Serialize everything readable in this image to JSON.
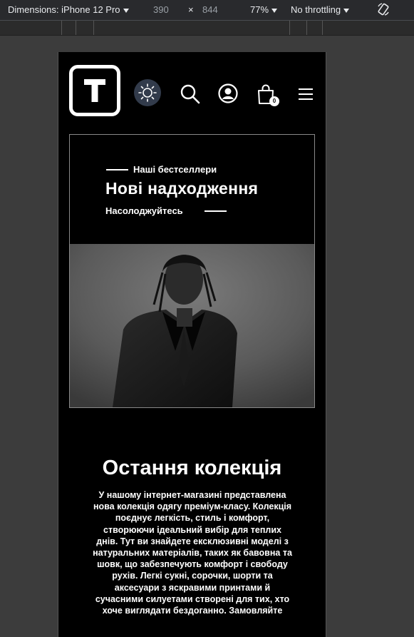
{
  "devtools": {
    "dimensions_label": "Dimensions: iPhone 12 Pro",
    "width": "390",
    "times": "×",
    "height": "844",
    "zoom": "77%",
    "throttling": "No throttling",
    "rotate_icon": "rotate-icon"
  },
  "header": {
    "logo_letter": "T",
    "logo_icon": "logo-t-icon",
    "theme_icon": "sun-icon",
    "search_icon": "search-icon",
    "account_icon": "user-circle-icon",
    "cart_icon": "shopping-bag-icon",
    "cart_count": "0",
    "menu_icon": "hamburger-menu-icon"
  },
  "hero": {
    "eyebrow": "Наші бестселлери",
    "title": "Нові надходження",
    "subtitle": "Насолоджуйтесь",
    "image_alt": "model-photo"
  },
  "section": {
    "title": "Остання колекція",
    "text": "У нашому інтернет-магазині представлена нова колекція одягу преміум-класу. Колекція поєднує легкість, стиль і комфорт, створюючи ідеальний вибір для теплих днів. Тут ви знайдете ексклюзивні моделі з натуральних матеріалів, таких як бавовна та шовк, що забезпечують комфорт і свободу рухів. Легкі сукні, сорочки, шорти та аксесуари з яскравими принтами й сучасними силуетами створені для тих, хто хоче виглядати бездоганно. Замовляйте"
  },
  "colors": {
    "page_bg": "#000000",
    "text": "#ffffff",
    "theme_button_bg": "#323b4b",
    "devtools_bg": "#292a2d"
  }
}
